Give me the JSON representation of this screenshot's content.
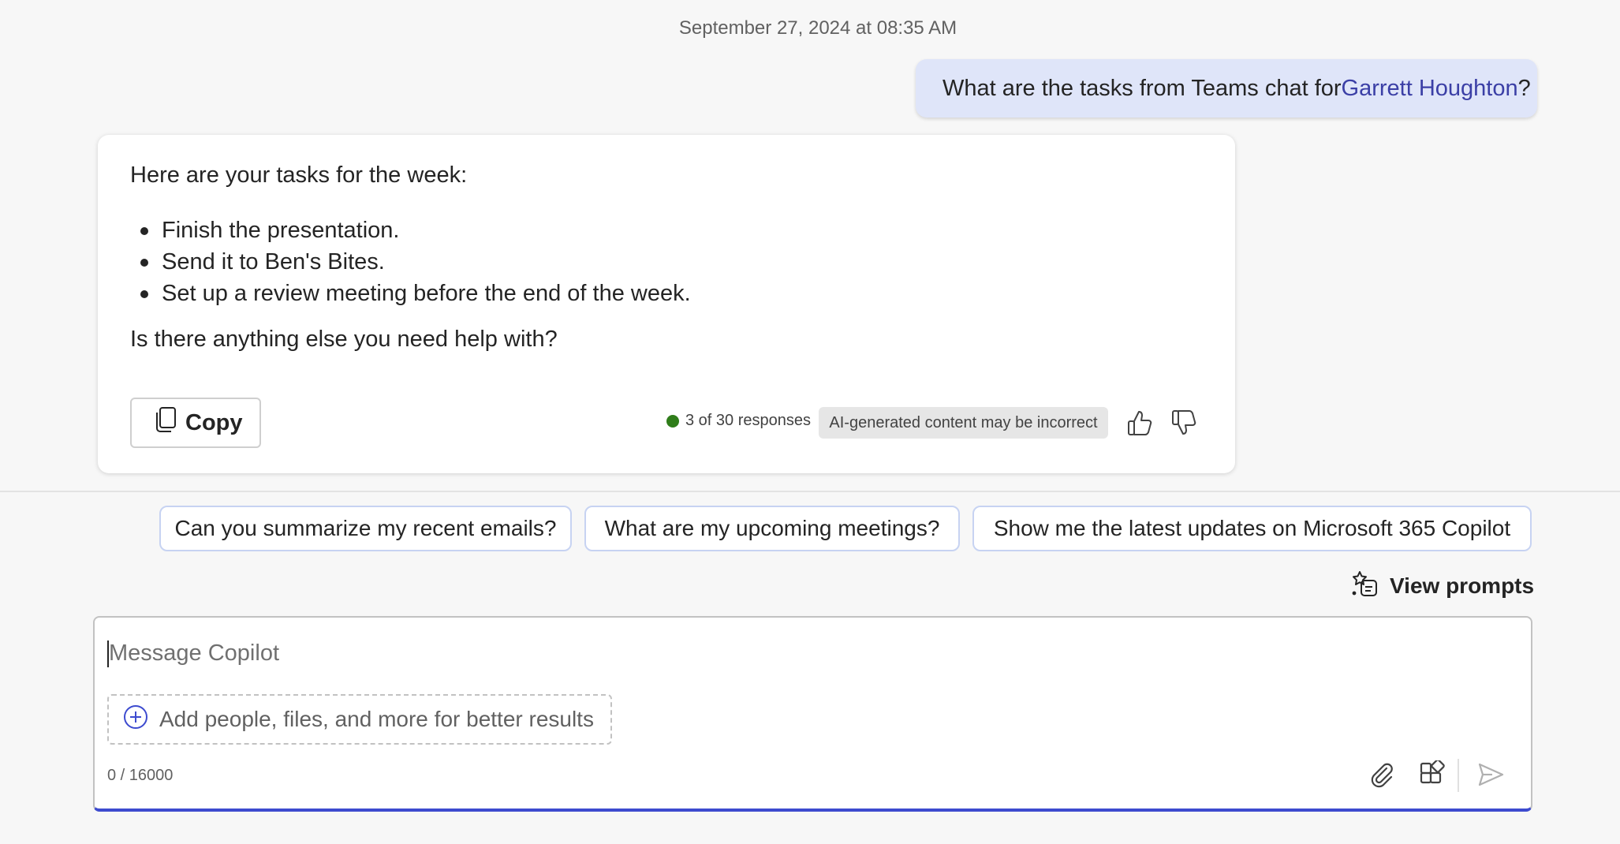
{
  "conversation": {
    "timestamp": "September 27, 2024 at 08:35 AM",
    "user_message": {
      "prefix": "What are the tasks from Teams chat for ",
      "mention": "Garrett Houghton",
      "suffix": "?"
    },
    "response": {
      "intro": "Here are your tasks for the week:",
      "tasks": [
        "Finish the presentation.",
        "Send it to Ben's Bites.",
        "Set up a review meeting before the end of the week."
      ],
      "outro": "Is there anything else you need help with?",
      "copy_label": "Copy",
      "response_count": "3 of 30 responses",
      "disclaimer": "AI-generated content may be incorrect"
    }
  },
  "suggestions": [
    "Can you summarize my recent emails?",
    "What are my upcoming meetings?",
    "Show me the latest updates on Microsoft 365 Copilot"
  ],
  "view_prompts_label": "View prompts",
  "composer": {
    "placeholder": "Message Copilot",
    "value": "",
    "add_context_label": "Add people, files, and more for better results",
    "char_count": "0 / 16000"
  },
  "icons": {
    "copy": "copy-icon",
    "thumbs_up": "thumbs-up-icon",
    "thumbs_down": "thumbs-down-icon",
    "view_prompts": "prompt-sparkle-icon",
    "add_context": "plus-circle-icon",
    "attach": "paperclip-icon",
    "apps": "apps-grid-icon",
    "send": "send-icon"
  },
  "colors": {
    "user_bubble": "#dfe5f9",
    "mention": "#3b3fa6",
    "status_dot": "#2f7d1a",
    "suggestion_border": "#c7d3f2",
    "composer_focus": "#3d4bcf"
  }
}
